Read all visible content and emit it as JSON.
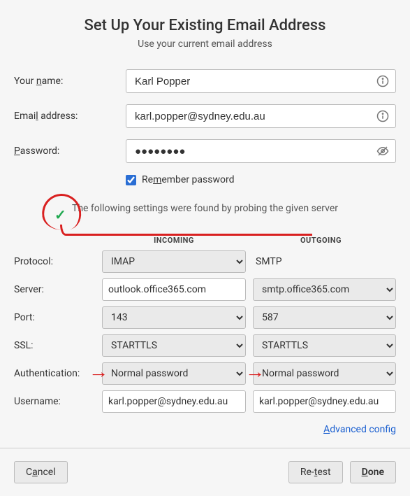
{
  "header": {
    "title": "Set Up Your Existing Email Address",
    "subtitle": "Use your current email address"
  },
  "fields": {
    "name_label_pre": "Your ",
    "name_label_hot": "n",
    "name_label_post": "ame:",
    "name_value": "Karl Popper",
    "email_label_pre": "Emai",
    "email_label_hot": "l",
    "email_label_post": " address:",
    "email_value": "karl.popper@sydney.edu.au",
    "password_label_hot": "P",
    "password_label_post": "assword:",
    "password_value": "●●●●●●●●",
    "remember_pre": "Re",
    "remember_hot": "m",
    "remember_post": "ember password",
    "remember_checked": true
  },
  "success_msg": "The following settings were found by probing the given server",
  "columns": {
    "incoming": "INCOMING",
    "outgoing": "OUTGOING"
  },
  "server": {
    "protocol_label": "Protocol:",
    "protocol_in": "IMAP",
    "protocol_out": "SMTP",
    "server_label": "Server:",
    "server_in": "outlook.office365.com",
    "server_out": "smtp.office365.com",
    "port_label": "Port:",
    "port_in": "143",
    "port_out": "587",
    "ssl_label": "SSL:",
    "ssl_in": "STARTTLS",
    "ssl_out": "STARTTLS",
    "auth_label": "Authentication:",
    "auth_in": "Normal password",
    "auth_out": "Normal password",
    "user_label": "Username:",
    "user_in": "karl.popper@sydney.edu.au",
    "user_out": "karl.popper@sydney.edu.au"
  },
  "links": {
    "advanced_hot": "A",
    "advanced_post": "dvanced config"
  },
  "buttons": {
    "cancel_pre": "C",
    "cancel_hot": "a",
    "cancel_post": "ncel",
    "retest_pre": "Re-",
    "retest_hot": "t",
    "retest_post": "est",
    "done_hot": "D",
    "done_post": "one"
  }
}
